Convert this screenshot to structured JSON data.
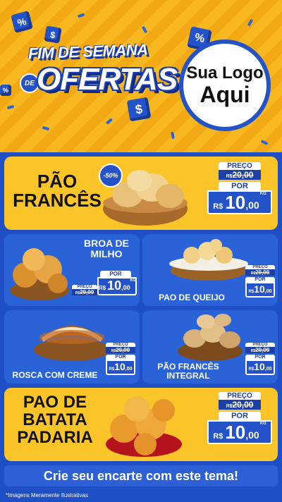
{
  "header": {
    "title_line1": "FIM DE SEMANA",
    "title_de": "DE",
    "title_line2": "OFERTAS",
    "logo_line1": "Sua Logo",
    "logo_line2": "Aqui"
  },
  "products": [
    {
      "name": "PÃO FRANCÊS",
      "label_preco": "PREÇO",
      "old_currency": "R$",
      "old_price": "20,00",
      "label_por": "POR",
      "currency": "R$",
      "price_int": "10",
      "price_dec": ",00",
      "unit": "KG",
      "badge": "-50%"
    },
    {
      "name": "BROA DE MILHO",
      "label_preco": "PREÇO",
      "old_currency": "R$",
      "old_price": "20,00",
      "label_por": "POR",
      "currency": "R$",
      "price_int": "10",
      "price_dec": ",00",
      "unit": "KG"
    },
    {
      "name": "PAO DE QUEIJO",
      "label_preco": "PREÇO",
      "old_currency": "R$",
      "old_price": "20,00",
      "label_por": "POR",
      "currency": "R$",
      "price_int": "10",
      "price_dec": ",00",
      "unit": "KG"
    },
    {
      "name": "ROSCA COM CREME",
      "label_preco": "PREÇO",
      "old_currency": "R$",
      "old_price": "20,00",
      "label_por": "POR",
      "currency": "R$",
      "price_int": "10",
      "price_dec": ",00",
      "unit": "KG"
    },
    {
      "name": "PÃO FRANCÊS INTEGRAL",
      "label_preco": "PREÇO",
      "old_currency": "R$",
      "old_price": "20,00",
      "label_por": "POR",
      "currency": "R$",
      "price_int": "10",
      "price_dec": ",00",
      "unit": "KG"
    },
    {
      "name": "PAO DE BATATA PADARIA",
      "label_preco": "PREÇO",
      "old_currency": "R$",
      "old_price": "20,00",
      "label_por": "POR",
      "currency": "R$",
      "price_int": "10",
      "price_dec": ",00",
      "unit": "KG"
    }
  ],
  "cta": "Crie seu encarte com este tema!",
  "footnote": "*Imagens Meramente Ilustrativas",
  "colors": {
    "yellow": "#fbc52a",
    "blue": "#2452c8",
    "dark_blue": "#1d3fa8"
  }
}
